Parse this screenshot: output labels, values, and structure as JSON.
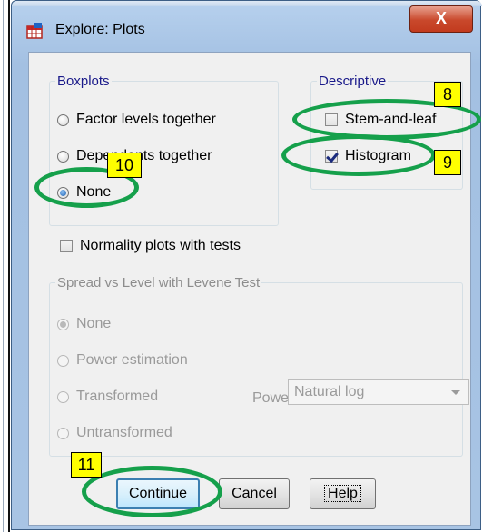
{
  "window": {
    "title": "Explore: Plots",
    "close_glyph": "X",
    "icon": "spss-table-icon"
  },
  "boxplots": {
    "legend": "Boxplots",
    "options": [
      {
        "label": "Factor levels together",
        "selected": false
      },
      {
        "label": "Dependents together",
        "selected": false
      },
      {
        "label": "None",
        "selected": true
      }
    ]
  },
  "descriptive": {
    "legend": "Descriptive",
    "stem_and_leaf": {
      "label": "Stem-and-leaf",
      "checked": false
    },
    "histogram": {
      "label": "Histogram",
      "checked": true
    }
  },
  "normality": {
    "label": "Normality plots with tests",
    "checked": false
  },
  "spread": {
    "legend": "Spread vs Level with Levene Test",
    "options": [
      {
        "label": "None",
        "selected": true
      },
      {
        "label": "Power estimation",
        "selected": false
      },
      {
        "label": "Transformed",
        "selected": false
      },
      {
        "label": "Untransformed",
        "selected": false
      }
    ],
    "power_label": "Power:",
    "power_value": "Natural log"
  },
  "buttons": {
    "continue": "Continue",
    "cancel": "Cancel",
    "help": "Help"
  },
  "annotations": {
    "stem": "8",
    "histogram": "9",
    "none": "10",
    "continue": "11",
    "color": "#15a04b",
    "tag_color": "#ffff00"
  }
}
